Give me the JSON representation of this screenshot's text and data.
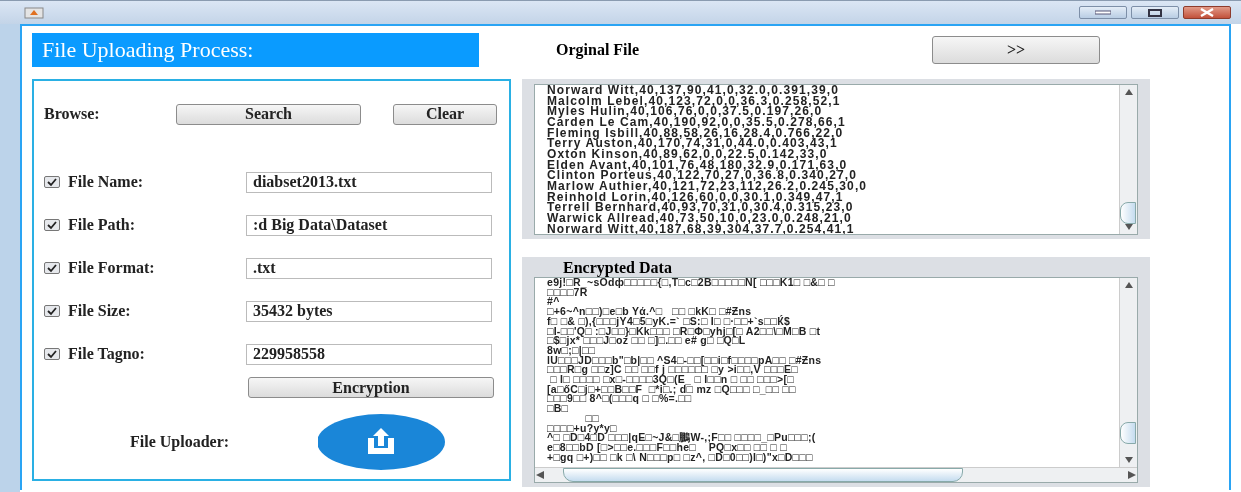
{
  "header": {
    "title": "File Uploading Process:"
  },
  "upload_panel": {
    "browse_label": "Browse:",
    "buttons": [
      {
        "label": "Search"
      },
      {
        "label": "Clear"
      }
    ],
    "fields": [
      {
        "label": "File Name:",
        "value": "diabset2013.txt",
        "checked": true
      },
      {
        "label": "File Path:",
        "value": ":d Big Data\\Dataset",
        "checked": true
      },
      {
        "label": "File Format:",
        "value": ".txt",
        "checked": true
      },
      {
        "label": "File Size:",
        "value": "35432 bytes",
        "checked": true
      },
      {
        "label": "File Tagno:",
        "value": "229958558",
        "checked": true
      }
    ],
    "encrypt_button": "Encryption",
    "uploader_label": "File Uploader:"
  },
  "original": {
    "label": "Orginal File",
    "next_button": ">>",
    "lines": [
      "Norward Witt,40,137,90,41,0,32.0,0.391,39,0",
      "Malcolm Lebel,40,123,72,0,0,36.3,0.258,52,1",
      "Myles Hulin,40,106,76,0,0,37.5,0.197,26,0",
      "Carden Le Cam,40,190,92,0,0,35.5,0.278,66,1",
      "Fleming Isbill,40,88,58,26,16,28.4,0.766,22,0",
      "Terry Auston,40,170,74,31,0,44.0,0.403,43,1",
      "Oxton Kinson,40,89,62,0,0,22.5,0.142,33,0",
      "Elden Avant,40,101,76,48,180,32.9,0.171,63,0",
      "Clinton Porteus,40,122,70,27,0,36.8,0.340,27,0",
      "Marlow Authier,40,121,72,23,112,26.2,0.245,30,0",
      "Reinhold Lorin,40,126,60,0,0,30.1,0.349,47,1",
      "Terrell Bernhard,40,93,70,31,0,30.4,0.315,23,0",
      "Warwick Allread,40,73,50,10,0,23.0,0.248,21,0",
      "Norward Witt,40,187,68,39,304,37.7,0.254,41,1"
    ]
  },
  "encrypted": {
    "label": "Encrypted Data",
    "lines": [
      "e9j!□R_~sOdф□□□□□{□,T□c□2B□□□□□N[ □□□K1□ □&□ □",
      "□□□□7R",
      "#^",
      "□+6~^n□□)□e□b Yά.^□   □□ □kK□ □#Ƶns",
      "f□ □& □),{□□□jY4□5□yK.=` □S:□ I□ □·□□+`s□□Ќ$",
      "□I-□□'Q□ :□J□□}□Kk□□□ □R□Φ□yhj□[□ A2□□\\□M□B □t",
      "□$□jx* □□□J□oz □□ □]□.□□ e# g□ □Q□L",
      "8w□;□|□□",
      "lU□□□JD□□□b\"□b|□□ ^S4□-□□[□□i□f□□□□pA□□ □#Ƶns",
      "□□□R□g □□z]C □□ □□f j □□□□□□ □y >i□□,V □□□E□",
      " □ I□ □□□□ □x□-□□□□3Q□(E_ □ I□□n □ □□ □□□>[□",
      "[a□őC□j□+□□B□□F  □*i□.; d□ mz □Q□□□ □_□□ □□",
      "□□□9□□ 8^□(□□□q □ □%=.□□",
      "□B□",
      "            □□",
      "□□□□+u?y*y□",
      "^□ □D□4□D □□□|qE□~J&□鵬W-,;F□□ □□□□_□Pu□□□;(",
      "e□8□□bD [□>□□e.□□□F□□he□    PQ□x□□ □□ □ □",
      "+□gq □+)□□ □k □\\ N□□□p□ □z^, □D□0□□)I□)\"x□D□□□"
    ]
  }
}
